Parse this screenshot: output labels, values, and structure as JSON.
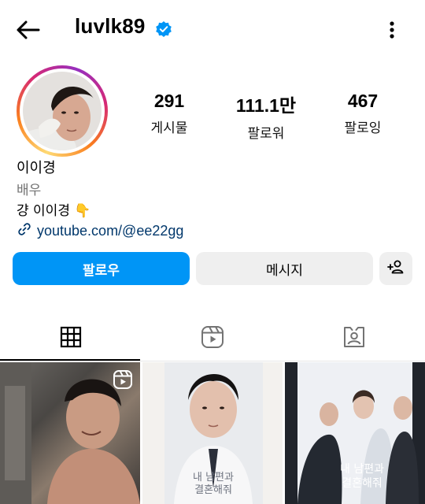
{
  "header": {
    "username": "luvlk89",
    "verified_icon": "verified-badge-icon",
    "back_icon": "back-arrow-icon",
    "more_icon": "more-vertical-icon"
  },
  "profile": {
    "avatar_icon": "profile-avatar",
    "stats": [
      {
        "value": "291",
        "label": "게시물"
      },
      {
        "value": "111.1만",
        "label": "팔로워"
      },
      {
        "value": "467",
        "label": "팔로잉"
      }
    ],
    "name": "이이경",
    "category": "배우",
    "bio": "걍 이이경 👇",
    "link": "youtube.com/@ee22gg"
  },
  "actions": {
    "follow_label": "팔로우",
    "message_label": "메시지",
    "suggest_icon": "add-person-icon"
  },
  "tabs": [
    {
      "icon": "grid-icon",
      "active": true
    },
    {
      "icon": "reels-icon",
      "active": false
    },
    {
      "icon": "tagged-icon",
      "active": false
    }
  ],
  "colors": {
    "accent": "#0095f6",
    "link": "#00376b",
    "muted": "#737373",
    "button_bg": "#efefef"
  },
  "posts": [
    {
      "type": "reel",
      "badge_icon": "reels-icon"
    },
    {
      "type": "image",
      "poster_text": "내 남편과 결혼해줘"
    },
    {
      "type": "image",
      "poster_text": "내 남편과 결혼해줘"
    }
  ]
}
